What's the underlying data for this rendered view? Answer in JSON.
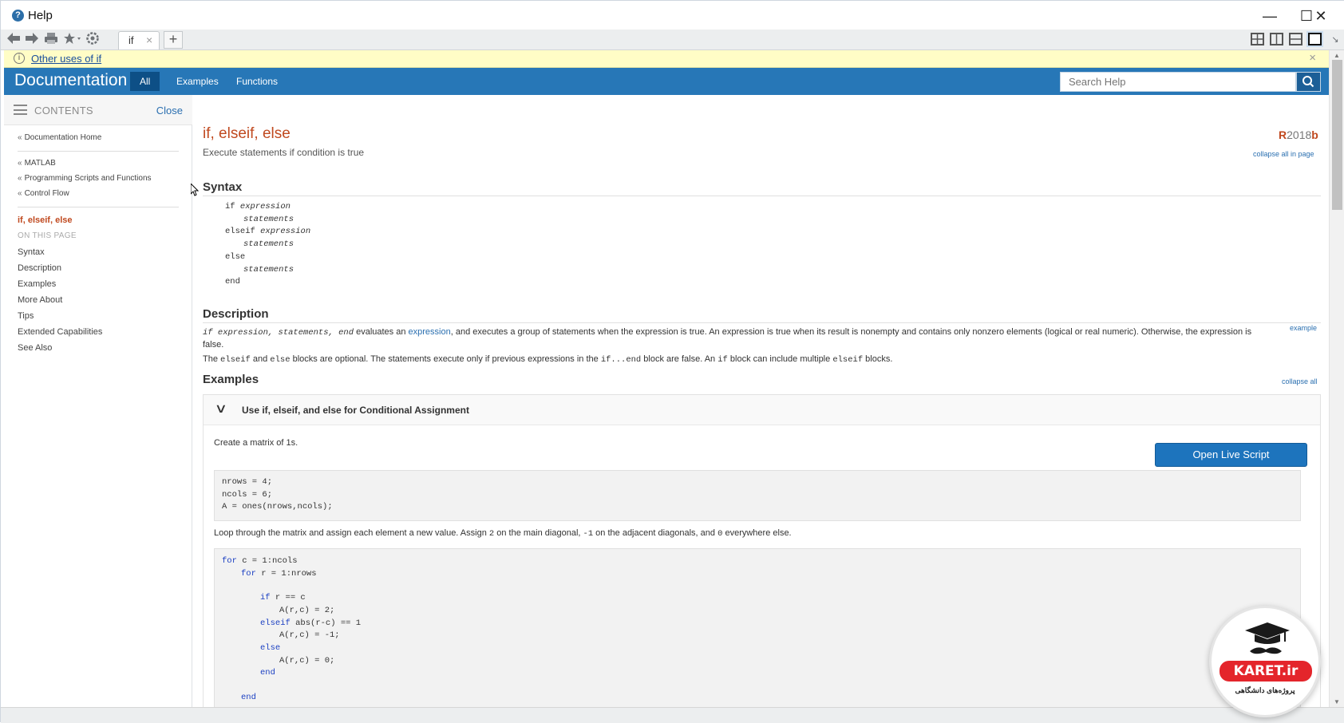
{
  "window": {
    "title": "Help",
    "controls": {
      "minimize": "—",
      "maximize": "☐",
      "close": "✕"
    }
  },
  "toolbar": {
    "tabs": [
      {
        "label": "if",
        "close": "×"
      }
    ],
    "add_tab": "+"
  },
  "infobar": {
    "link": "Other uses of if",
    "close": "×"
  },
  "docheader": {
    "title": "Documentation",
    "nav": [
      "All",
      "Examples",
      "Functions"
    ],
    "active_nav": "All",
    "search_placeholder": "Search Help",
    "accent": "#2777b7"
  },
  "sidebar": {
    "contents_label": "CONTENTS",
    "close_label": "Close",
    "crumbs": [
      "Documentation Home",
      "MATLAB",
      "Programming Scripts and Functions",
      "Control Flow"
    ],
    "current": "if, elseif, else",
    "on_this_page": "ON THIS PAGE",
    "sections": [
      "Syntax",
      "Description",
      "Examples",
      "More About",
      "Tips",
      "Extended Capabilities",
      "See Also"
    ]
  },
  "page": {
    "title": "if, elseif, else",
    "release_r": "R",
    "release_year": "2018",
    "release_b": "b",
    "subtitle": "Execute statements if condition is true",
    "collapse_all_page": "collapse all in page",
    "syntax_heading": "Syntax",
    "syntax_lines": [
      {
        "kw": "if",
        "arg": "expression"
      },
      {
        "kw": "",
        "arg": "statements"
      },
      {
        "kw": "elseif",
        "arg": "expression"
      },
      {
        "kw": "",
        "arg": "statements"
      },
      {
        "kw": "else",
        "arg": ""
      },
      {
        "kw": "",
        "arg": "statements"
      },
      {
        "kw": "end",
        "arg": ""
      }
    ],
    "description_heading": "Description",
    "desc1": {
      "code": "if expression, statements, end",
      "pre": " evaluates an ",
      "link": "expression",
      "post": ", and executes a group of statements when the expression is true. An expression is true when its result is nonempty and contains only nonzero elements (logical or real numeric). Otherwise, the expression is false."
    },
    "desc_example_link": "example",
    "desc2": {
      "t1": "The ",
      "c1": "elseif",
      "t2": " and ",
      "c2": "else",
      "t3": " blocks are optional. The statements execute only if previous expressions in the ",
      "c3": "if...end",
      "t4": " block are false. An ",
      "c4": "if",
      "t5": " block can include multiple ",
      "c5": "elseif",
      "t6": " blocks."
    },
    "examples_heading": "Examples",
    "collapse_all": "collapse all",
    "example": {
      "title": "Use if, elseif, and else for Conditional Assignment",
      "text1": "Create a matrix of 1s.",
      "live_script": "Open Live Script",
      "code1": [
        "nrows = 4;",
        "ncols = 6;",
        "A = ones(nrows,ncols);"
      ],
      "text2": {
        "a": "Loop through the matrix and assign each element a new value. Assign ",
        "b": "2",
        "c": " on the main diagonal, ",
        "d": "-1",
        "e": " on the adjacent diagonals, and ",
        "f": "0",
        "g": " everywhere else."
      },
      "code2": [
        {
          "kw": "for",
          "rest": " c = 1:ncols"
        },
        {
          "kw": "for",
          "rest": " r = 1:nrows"
        },
        {
          "kw": "",
          "rest": ""
        },
        {
          "kw": "if",
          "rest": " r == c"
        },
        {
          "kw": "",
          "rest": "A(r,c) = 2;"
        },
        {
          "kw": "elseif",
          "rest": " abs(r-c) == 1"
        },
        {
          "kw": "",
          "rest": "A(r,c) = -1;"
        },
        {
          "kw": "else",
          "rest": ""
        },
        {
          "kw": "",
          "rest": "A(r,c) = 0;"
        },
        {
          "kw": "end",
          "rest": ""
        },
        {
          "kw": "",
          "rest": ""
        },
        {
          "kw": "end",
          "rest": ""
        }
      ]
    }
  },
  "watermark": {
    "brand": "KARET.ir",
    "tagline": "پروژه‌های دانشگاهی"
  }
}
